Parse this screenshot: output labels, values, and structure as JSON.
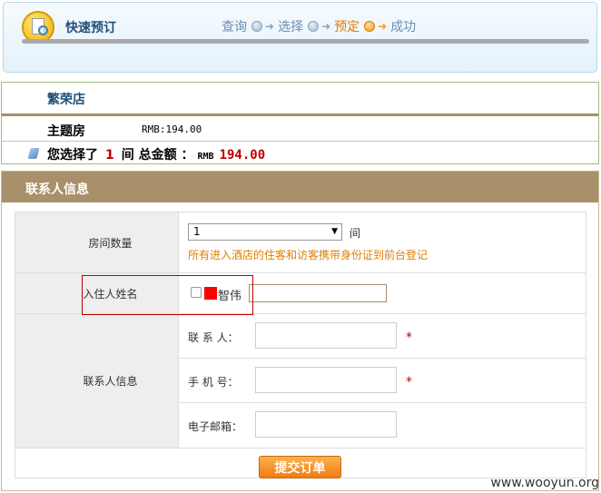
{
  "header": {
    "title": "快速预订",
    "steps": [
      {
        "label": "查询",
        "active": false
      },
      {
        "label": "选择",
        "active": false
      },
      {
        "label": "预定",
        "active": true
      },
      {
        "label": "成功",
        "active": true
      }
    ]
  },
  "hotel": {
    "name": "繁荣店",
    "room_type": "主题房",
    "room_price": "RMB:194.00",
    "summary": {
      "prefix": "您选择了",
      "count": "1",
      "unit_and_total": "间 总金额 ：",
      "currency": "RMB",
      "total": "194.00"
    }
  },
  "contact": {
    "section_title": "联系人信息",
    "room_count": {
      "label": "房间数量",
      "selected": "1",
      "unit": "间",
      "notice": "所有进入酒店的住客和访客携带身份证到前台登记"
    },
    "guest": {
      "label": "入住人姓名",
      "name_visible": "智伟",
      "input_value": ""
    },
    "contact_info": {
      "label": "联系人信息",
      "contact_person_label": "联 系 人：",
      "phone_label": "手 机 号：",
      "email_label": "电子邮箱：",
      "required_mark": "*"
    }
  },
  "actions": {
    "submit_label": "提交订单"
  },
  "watermark": "www.wooyun.org",
  "colors": {
    "section_header": "#a7906a",
    "accent_orange": "#f07c10",
    "price_red": "#c00000",
    "highlight_red": "#c00000"
  }
}
